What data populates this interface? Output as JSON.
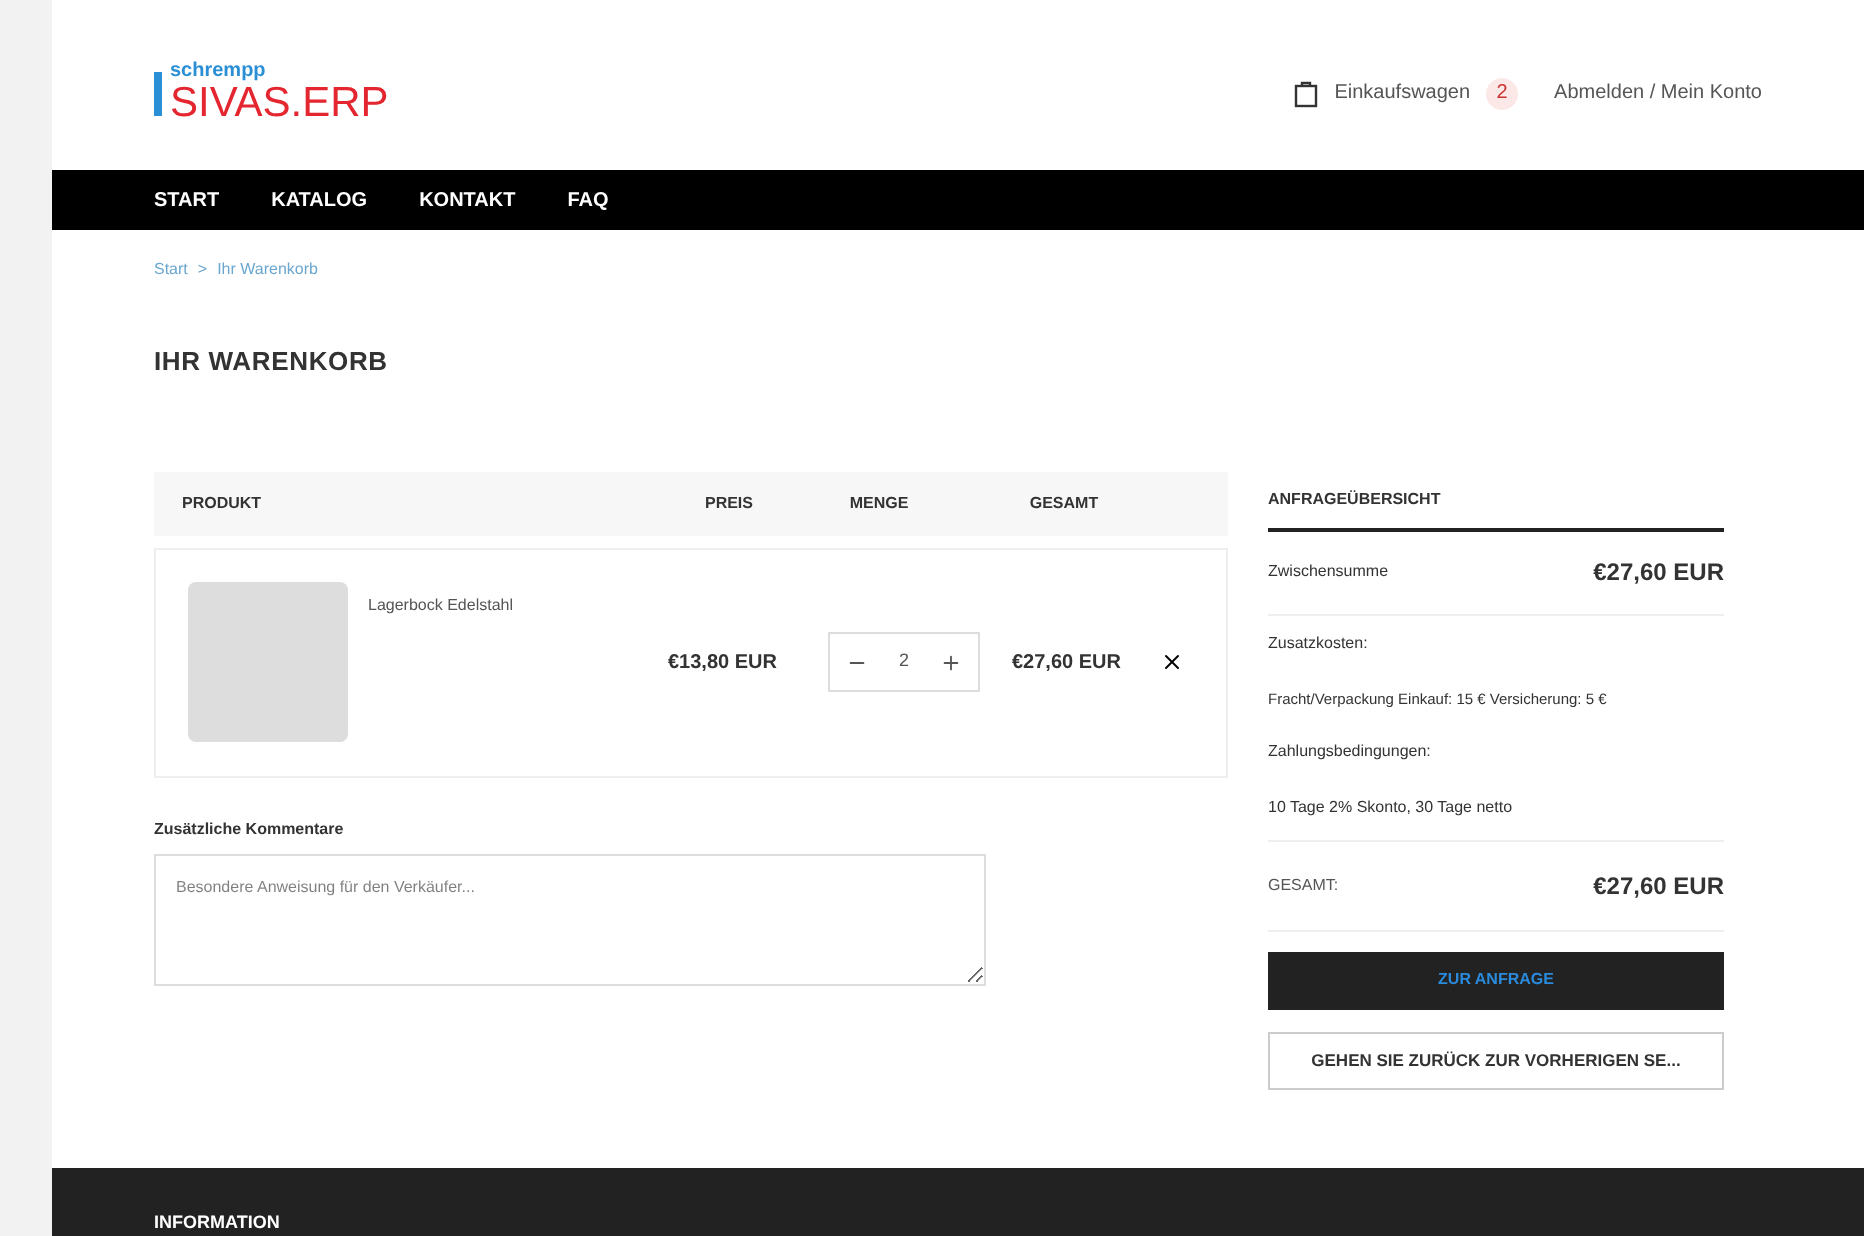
{
  "logo": {
    "small": "schrempp",
    "main": "SIVAS.ERP"
  },
  "header": {
    "cart_label": "Einkaufswagen",
    "cart_count": "2",
    "account_link": "Abmelden / Mein Konto"
  },
  "nav": [
    {
      "label": "START"
    },
    {
      "label": "KATALOG"
    },
    {
      "label": "KONTAKT"
    },
    {
      "label": "FAQ"
    }
  ],
  "breadcrumb": {
    "items": [
      "Start",
      "Ihr Warenkorb"
    ],
    "separator": ">"
  },
  "title": "IHR WARENKORB",
  "table": {
    "columns": [
      "PRODUKT",
      "PREIS",
      "MENGE",
      "GESAMT"
    ],
    "rows": [
      {
        "name": "Lagerbock Edelstahl",
        "price": "€13,80 EUR",
        "quantity": "2",
        "total": "€27,60 EUR"
      }
    ]
  },
  "comments": {
    "label": "Zusätzliche Kommentare",
    "placeholder": "Besondere Anweisung für den Verkäufer..."
  },
  "summary": {
    "title": "ANFRAGEÜBERSICHT",
    "subtotal_label": "Zwischensumme",
    "subtotal": "€27,60 EUR",
    "extra_costs_label": "Zusatzkosten:",
    "extra_costs": "Fracht/Verpackung Einkauf: 15 € Versicherung: 5 €",
    "payment_label": "Zahlungsbedingungen:",
    "payment": "10 Tage 2% Skonto, 30 Tage netto",
    "total_label": "GESAMT:",
    "total": "€27,60 EUR",
    "primary_button": "ZUR ANFRAGE",
    "secondary_button": "GEHEN SIE ZURÜCK ZUR VORHERIGEN SE..."
  },
  "footer": {
    "heading": "INFORMATION"
  }
}
